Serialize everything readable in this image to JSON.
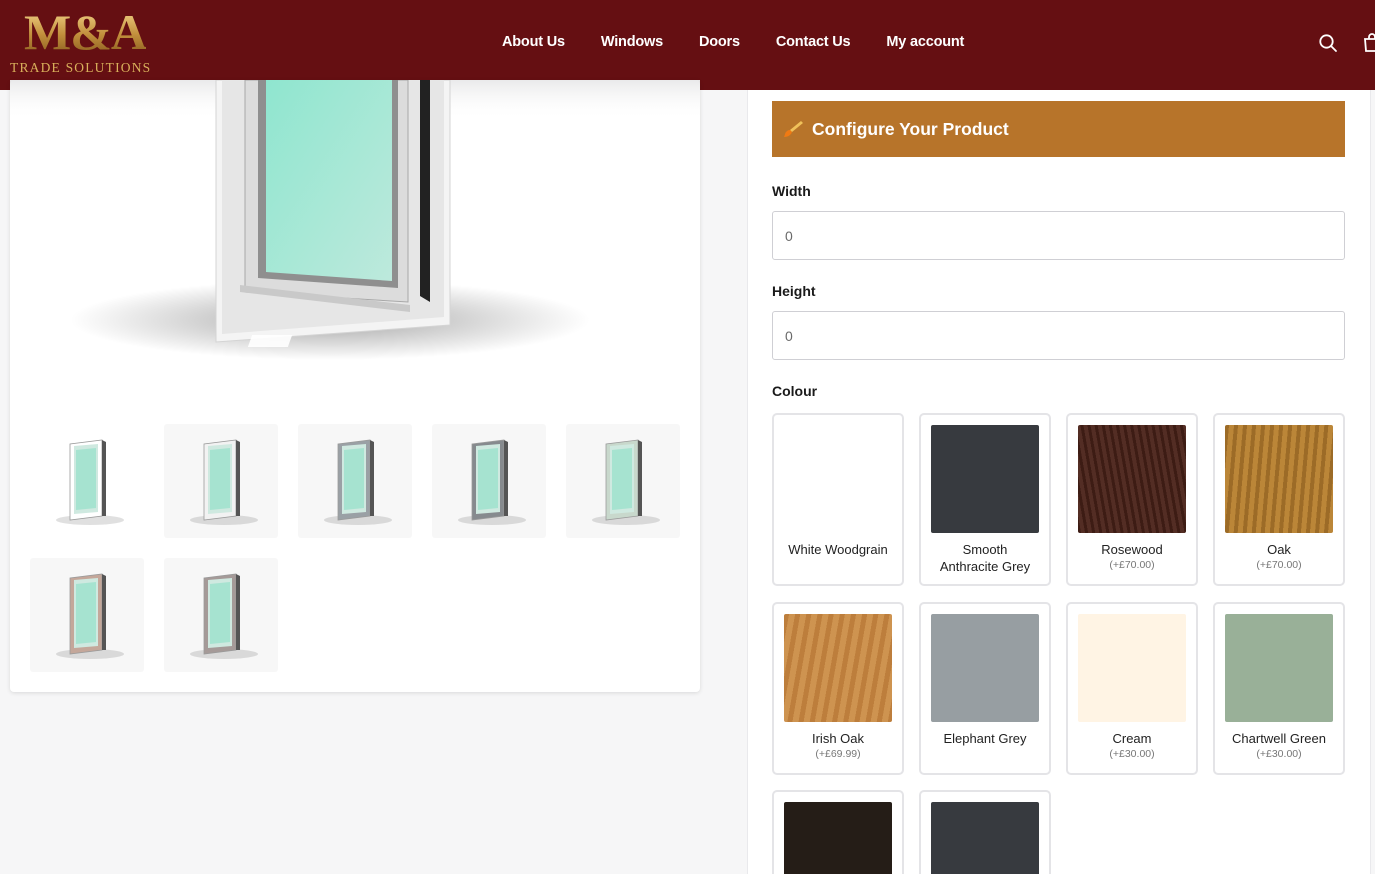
{
  "brand": {
    "logo_mark": "M&A",
    "logo_sub": "TRADE SOLUTIONS"
  },
  "nav": [
    {
      "label": "About Us"
    },
    {
      "label": "Windows"
    },
    {
      "label": "Doors"
    },
    {
      "label": "Contact Us"
    },
    {
      "label": "My account"
    }
  ],
  "header_icons": [
    "search-icon",
    "cart-icon"
  ],
  "configure": {
    "title": "Configure Your Product",
    "icon": "brush-icon"
  },
  "width": {
    "label": "Width",
    "placeholder": "0"
  },
  "height": {
    "label": "Height",
    "placeholder": "0"
  },
  "colour": {
    "label": "Colour",
    "options": [
      {
        "name": "White Woodgrain",
        "price": "",
        "color": "#ffffff"
      },
      {
        "name": "Smooth Anthracite Grey",
        "price": "",
        "color": "#373a3f"
      },
      {
        "name": "Rosewood",
        "price": "(+£70.00)",
        "color": "#4a2218"
      },
      {
        "name": "Oak",
        "price": "(+£70.00)",
        "color": "#b27a2c"
      },
      {
        "name": "Irish Oak",
        "price": "(+£69.99)",
        "color": "#c98a45"
      },
      {
        "name": "Elephant Grey",
        "price": "",
        "color": "#979ea2"
      },
      {
        "name": "Cream",
        "price": "(+£30.00)",
        "color": "#fff4e4"
      },
      {
        "name": "Chartwell Green",
        "price": "(+£30.00)",
        "color": "#99b098"
      },
      {
        "name": "",
        "price": "",
        "color": "#251d17"
      },
      {
        "name": "",
        "price": "",
        "color": "#373a3f"
      }
    ]
  },
  "gallery": {
    "thumb_frames": [
      "#ffffff",
      "#f2f2f2",
      "#9aa0a5",
      "#868a8e",
      "#c8d8cc",
      "#c4a79a",
      "#a59a98"
    ]
  }
}
